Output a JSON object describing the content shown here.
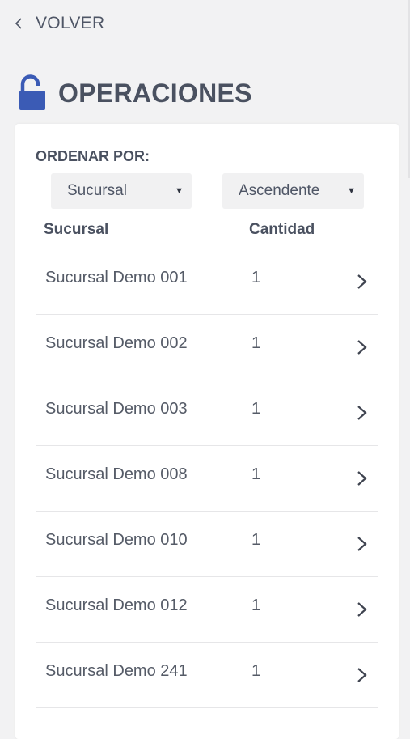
{
  "nav": {
    "back_label": "VOLVER",
    "back_icon": "chevron-left-icon"
  },
  "header": {
    "title": "OPERACIONES",
    "icon": "lock-open-icon",
    "icon_color": "#3b5bb5"
  },
  "sort": {
    "label": "ORDENAR POR:",
    "field_value": "Sucursal",
    "order_value": "Ascendente"
  },
  "table": {
    "columns": [
      "Sucursal",
      "Cantidad"
    ],
    "rows": [
      {
        "name": "Sucursal Demo 001",
        "qty": "1"
      },
      {
        "name": "Sucursal Demo 002",
        "qty": "1"
      },
      {
        "name": "Sucursal Demo 003",
        "qty": "1"
      },
      {
        "name": "Sucursal Demo 008",
        "qty": "1"
      },
      {
        "name": "Sucursal Demo 010",
        "qty": "1"
      },
      {
        "name": "Sucursal Demo 012",
        "qty": "1"
      },
      {
        "name": "Sucursal Demo 241",
        "qty": "1"
      }
    ]
  },
  "colors": {
    "background": "#f2f2f3",
    "card": "#ffffff",
    "text": "#4a5160",
    "accent": "#3b5bb5"
  }
}
